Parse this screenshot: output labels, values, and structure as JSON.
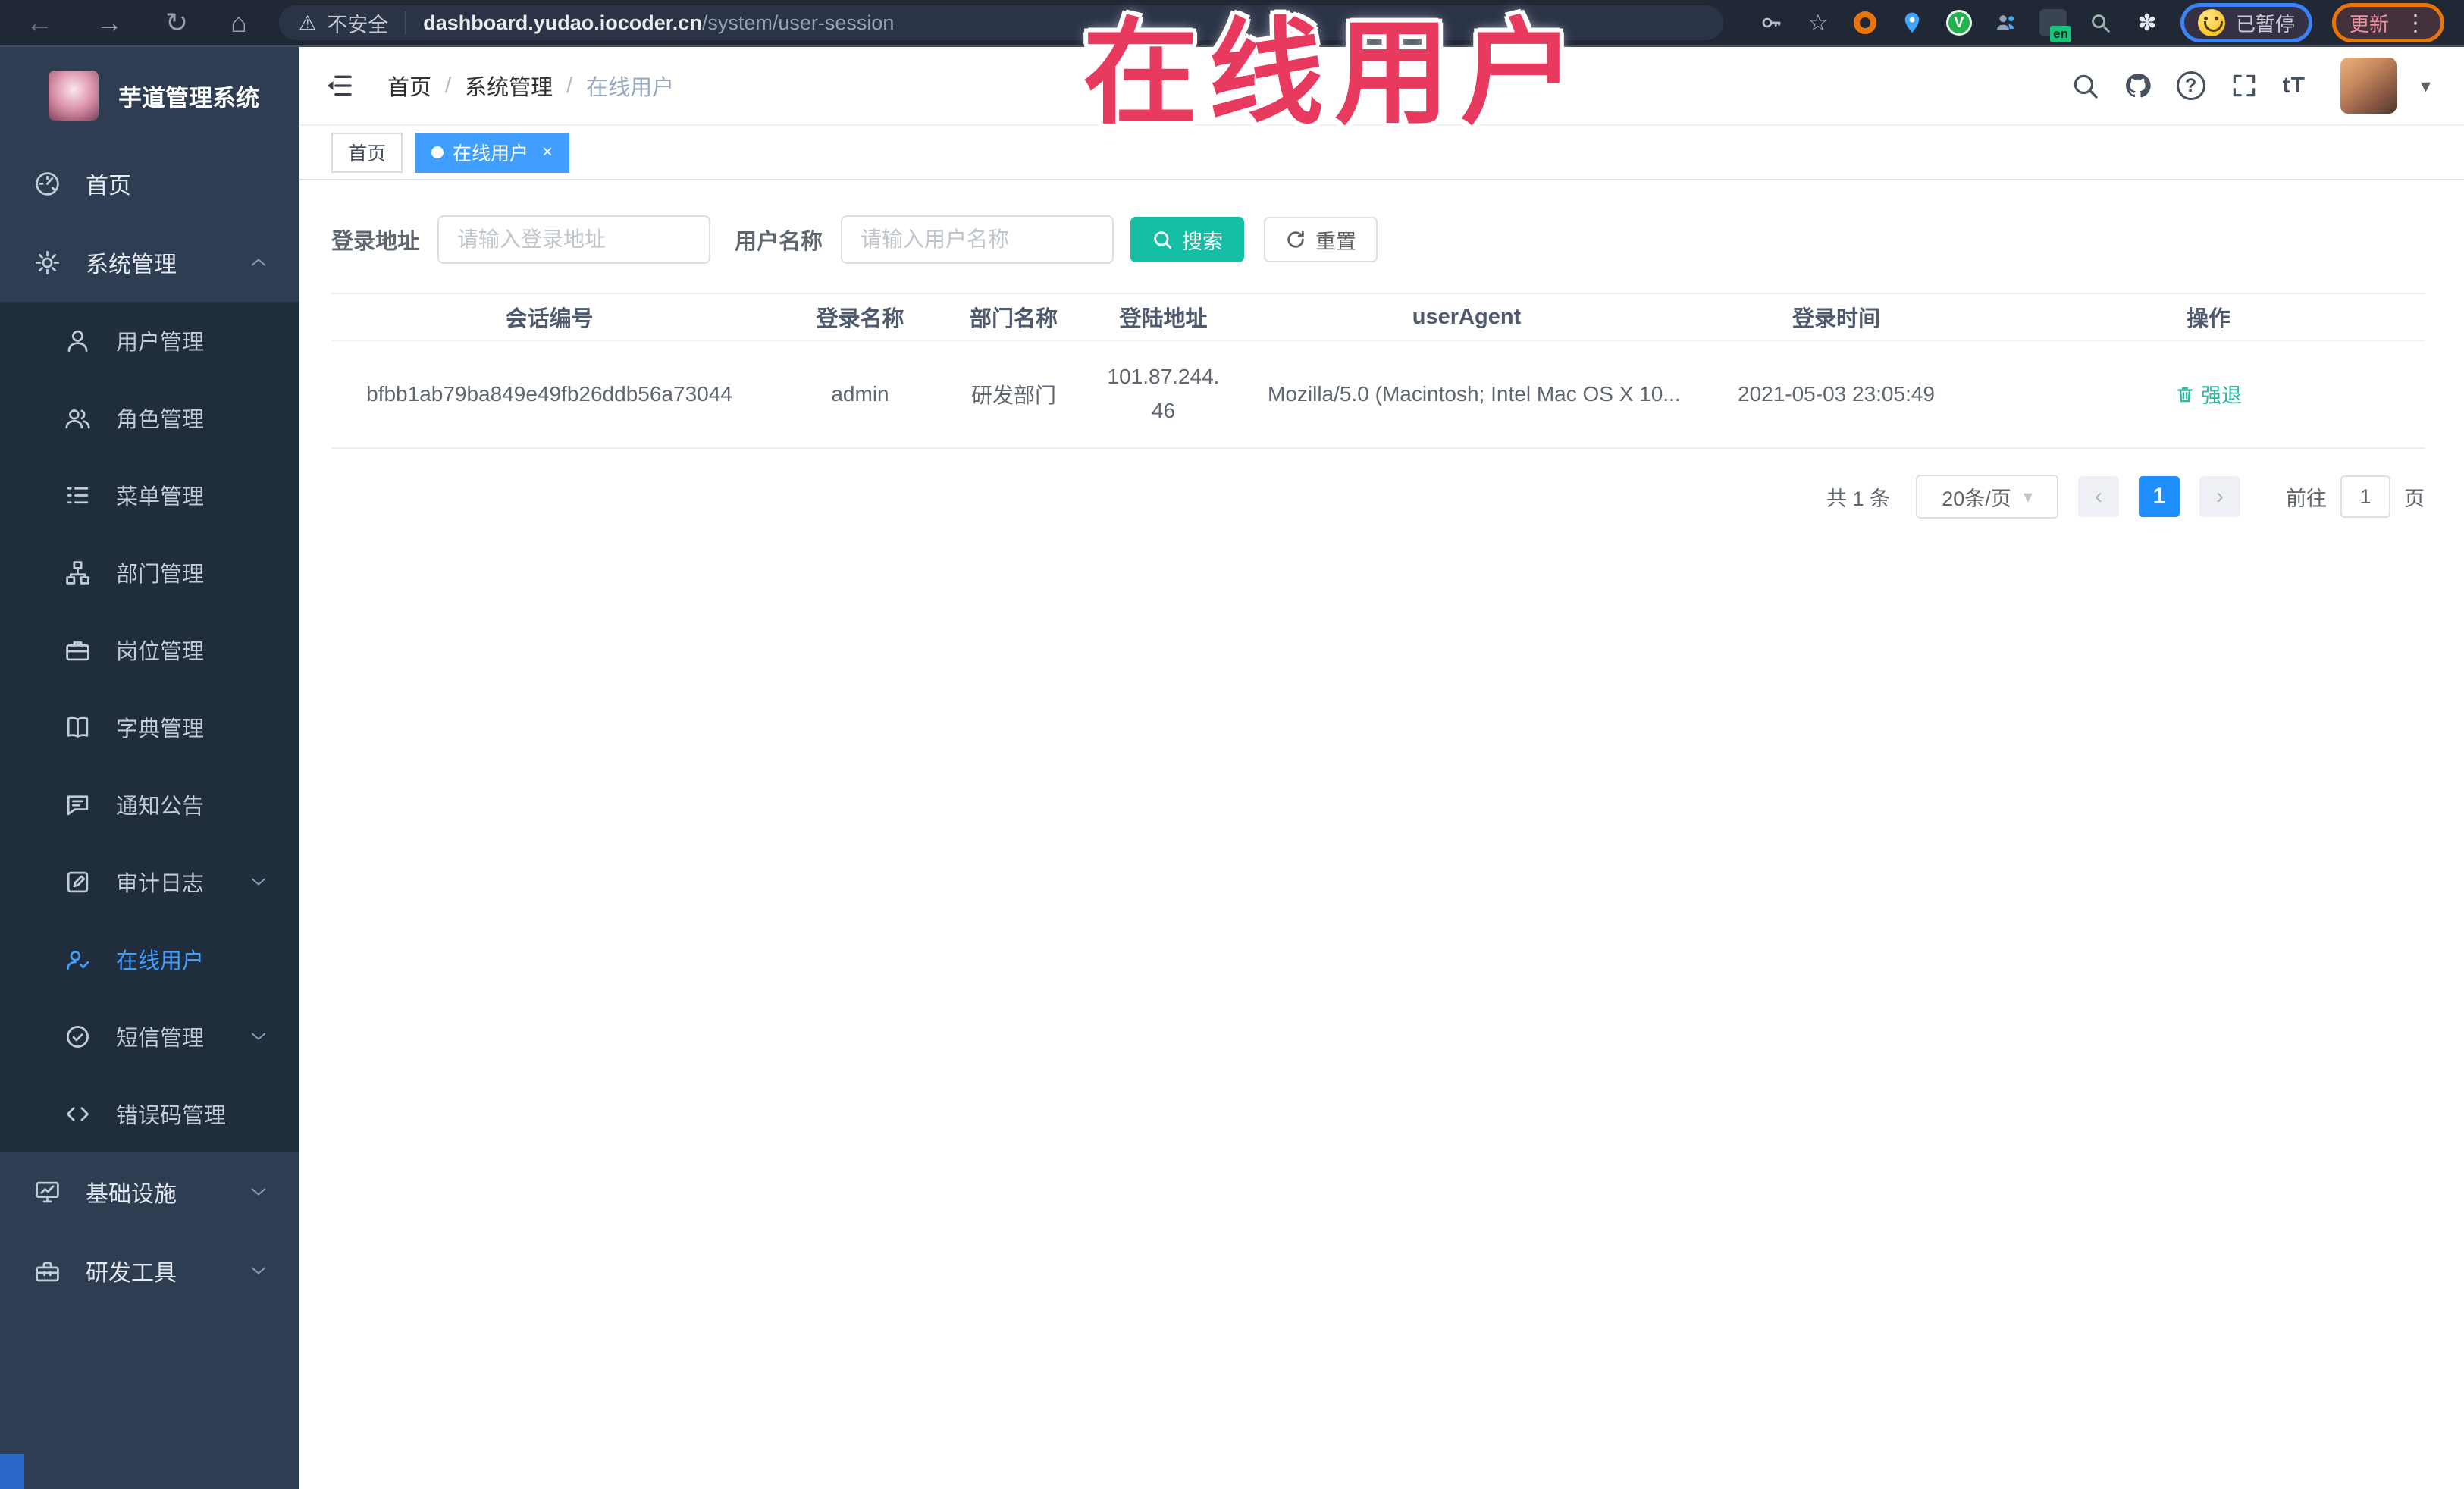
{
  "colors": {
    "accent_blue": "#409eff",
    "search_teal": "#14bfa6",
    "annotation_red": "#e8395e",
    "sidebar_bg": "#2f3d52",
    "submenu_bg": "#1f2d3d",
    "action_teal": "#2cb9a0"
  },
  "icons": {
    "back": "←",
    "forward": "→",
    "reload": "↻",
    "home": "⌂",
    "warning": "⚠",
    "star": "☆",
    "pinwheel": "✽",
    "dots": "⋮",
    "ext_v": "V",
    "ext_en": "en",
    "close": "×",
    "caret": "▾",
    "prev": "‹",
    "next": "›",
    "font_size": "tT",
    "question": "?"
  },
  "browser": {
    "security_label": "不安全",
    "url_host": "dashboard.yudao.iocoder.cn",
    "url_path": "/system/user-session",
    "paused_label": "已暂停",
    "update_label": "更新"
  },
  "annotation": {
    "text": "在线用户"
  },
  "sidebar": {
    "logo_title": "芋道管理系统",
    "items": [
      {
        "label": "首页"
      },
      {
        "label": "系统管理"
      },
      {
        "label": "用户管理"
      },
      {
        "label": "角色管理"
      },
      {
        "label": "菜单管理"
      },
      {
        "label": "部门管理"
      },
      {
        "label": "岗位管理"
      },
      {
        "label": "字典管理"
      },
      {
        "label": "通知公告"
      },
      {
        "label": "审计日志"
      },
      {
        "label": "在线用户"
      },
      {
        "label": "短信管理"
      },
      {
        "label": "错误码管理"
      },
      {
        "label": "基础设施"
      },
      {
        "label": "研发工具"
      }
    ]
  },
  "header": {
    "breadcrumb": [
      "首页",
      "系统管理",
      "在线用户"
    ],
    "separator": "/"
  },
  "tags": {
    "home": "首页",
    "active": "在线用户"
  },
  "filters": {
    "address_label": "登录地址",
    "address_placeholder": "请输入登录地址",
    "name_label": "用户名称",
    "name_placeholder": "请输入用户名称",
    "search": "搜索",
    "reset": "重置"
  },
  "table": {
    "columns": [
      "会话编号",
      "登录名称",
      "部门名称",
      "登陆地址",
      "userAgent",
      "登录时间",
      "操作"
    ],
    "rows": [
      {
        "session_id": "bfbb1ab79ba849e49fb26ddb56a73044",
        "username": "admin",
        "department": "研发部门",
        "ip": "101.87.244.46",
        "user_agent": "Mozilla/5.0 (Macintosh; Intel Mac OS X 10...",
        "login_time": "2021-05-03 23:05:49",
        "action": "强退"
      }
    ]
  },
  "pagination": {
    "total": "共 1 条",
    "page_size": "20条/页",
    "page": "1",
    "goto": "前往",
    "goto_value": "1",
    "unit": "页"
  }
}
